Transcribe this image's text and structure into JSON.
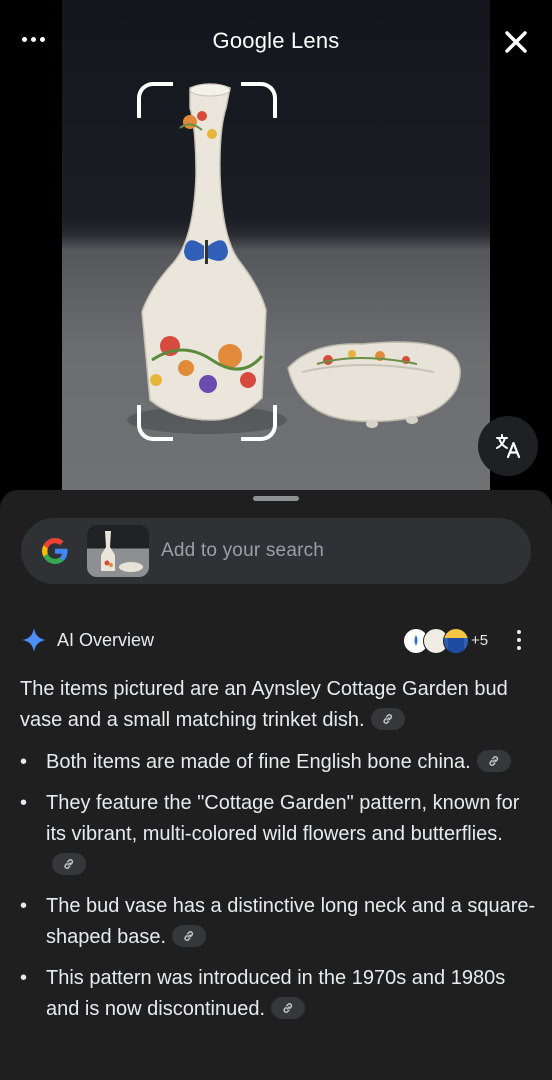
{
  "header": {
    "title": "Google Lens",
    "more_icon": "more-horizontal-icon",
    "close_icon": "close-icon"
  },
  "translate_icon": "translate-icon",
  "search": {
    "placeholder": "Add to your search"
  },
  "ai_overview": {
    "title": "AI Overview",
    "source_count": "+5",
    "summary": "The items pictured are an Aynsley Cottage Garden bud vase and a small matching trinket dish.",
    "bullets": [
      "Both items are made of fine English bone china.",
      "They feature the \"Cottage Garden\" pattern, known for its vibrant, multi-colored wild flowers and butterflies.",
      "The bud vase has a distinctive long neck and a square-shaped base.",
      "This pattern was introduced in the 1970s and 1980s and is now discontinued."
    ]
  },
  "colors": {
    "sheet_bg": "#1f1f1f",
    "pill_bg": "#303134",
    "text": "#e8eaed",
    "muted": "#9aa0a6",
    "ai_spark": "#4c8df6"
  }
}
